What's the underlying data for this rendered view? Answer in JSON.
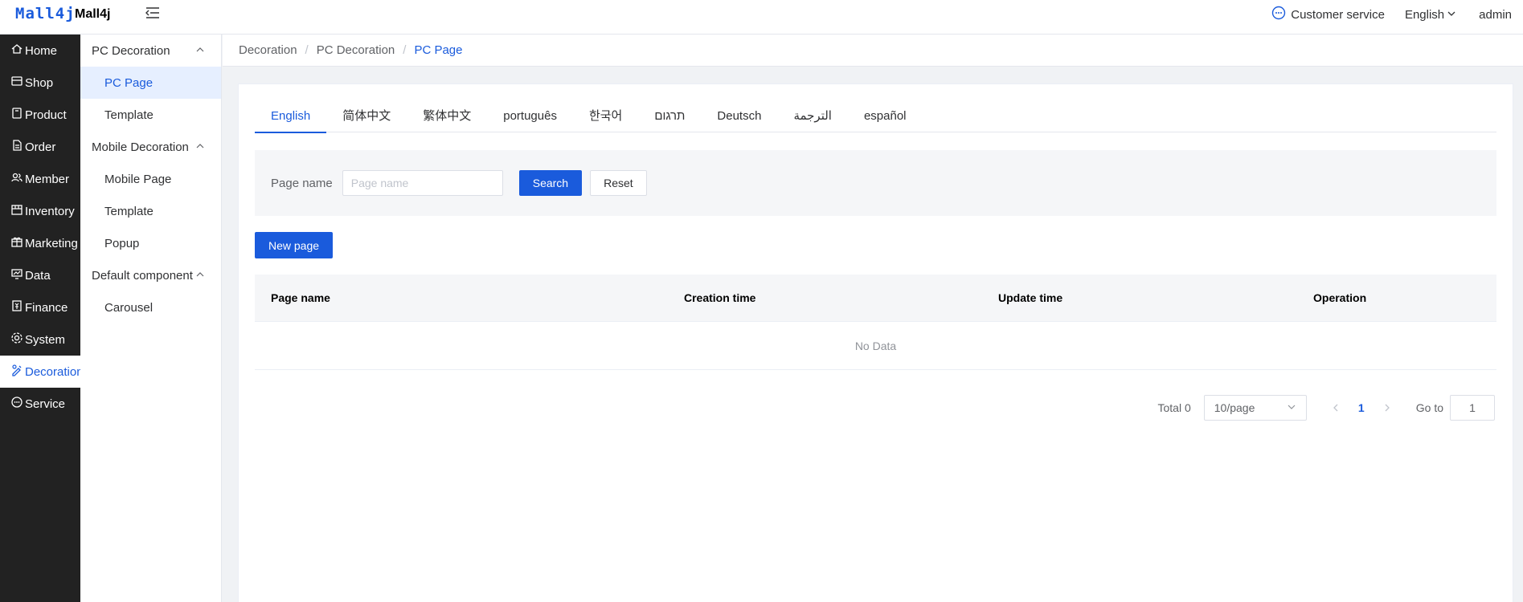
{
  "header": {
    "logo_text": "Mall4j",
    "brand": "Mall4j",
    "customer_service": "Customer service",
    "language": "English",
    "user": "admin"
  },
  "sidebar": {
    "items": [
      {
        "label": "Home",
        "icon": "home-icon"
      },
      {
        "label": "Shop",
        "icon": "shop-icon"
      },
      {
        "label": "Product",
        "icon": "product-icon"
      },
      {
        "label": "Order",
        "icon": "order-icon"
      },
      {
        "label": "Member",
        "icon": "member-icon"
      },
      {
        "label": "Inventory",
        "icon": "inventory-icon"
      },
      {
        "label": "Marketing",
        "icon": "marketing-icon"
      },
      {
        "label": "Data",
        "icon": "data-icon"
      },
      {
        "label": "Finance",
        "icon": "finance-icon"
      },
      {
        "label": "System",
        "icon": "system-icon"
      },
      {
        "label": "Decoration",
        "icon": "decoration-icon",
        "active": true
      },
      {
        "label": "Service",
        "icon": "service-icon"
      }
    ]
  },
  "submenu": {
    "groups": [
      {
        "label": "PC Decoration",
        "items": [
          "PC Page",
          "Template"
        ]
      },
      {
        "label": "Mobile Decoration",
        "items": [
          "Mobile Page",
          "Template",
          "Popup"
        ]
      },
      {
        "label": "Default component",
        "items": [
          "Carousel"
        ]
      }
    ],
    "active_item": "PC Page"
  },
  "breadcrumb": [
    "Decoration",
    "PC Decoration",
    "PC Page"
  ],
  "tabs": [
    "English",
    "简体中文",
    "繁体中文",
    "português",
    "한국어",
    "תרגום",
    "Deutsch",
    "الترجمة",
    "español"
  ],
  "search": {
    "label": "Page name",
    "placeholder": "Page name",
    "search_button": "Search",
    "reset_button": "Reset"
  },
  "new_page_button": "New page",
  "table": {
    "columns": [
      "Page name",
      "Creation time",
      "Update time",
      "Operation"
    ],
    "empty_text": "No Data"
  },
  "pagination": {
    "total": "Total 0",
    "page_size": "10/page",
    "current_page": "1",
    "goto_label": "Go to",
    "goto_value": "1"
  },
  "colors": {
    "accent": "#1a5bdc",
    "sidebar_bg": "#222222"
  }
}
